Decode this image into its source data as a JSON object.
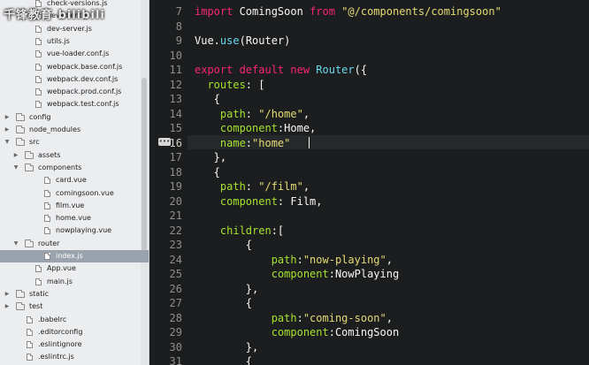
{
  "watermark": "千锋教育 bilibili",
  "sidebar": {
    "items": [
      {
        "label": "check-versions.js",
        "type": "file",
        "indent": 3
      },
      {
        "label": "dev-client.js",
        "type": "file",
        "indent": 3
      },
      {
        "label": "dev-server.js",
        "type": "file",
        "indent": 3
      },
      {
        "label": "utils.js",
        "type": "file",
        "indent": 3
      },
      {
        "label": "vue-loader.conf.js",
        "type": "file",
        "indent": 3
      },
      {
        "label": "webpack.base.conf.js",
        "type": "file",
        "indent": 3
      },
      {
        "label": "webpack.dev.conf.js",
        "type": "file",
        "indent": 3
      },
      {
        "label": "webpack.prod.conf.js",
        "type": "file",
        "indent": 3
      },
      {
        "label": "webpack.test.conf.js",
        "type": "file",
        "indent": 3
      },
      {
        "label": "config",
        "type": "folder",
        "indent": 1,
        "expanded": false
      },
      {
        "label": "node_modules",
        "type": "folder",
        "indent": 1,
        "expanded": false
      },
      {
        "label": "src",
        "type": "folder",
        "indent": 1,
        "expanded": true
      },
      {
        "label": "assets",
        "type": "folder",
        "indent": 2,
        "expanded": false
      },
      {
        "label": "components",
        "type": "folder",
        "indent": 2,
        "expanded": true
      },
      {
        "label": "card.vue",
        "type": "file",
        "indent": 4
      },
      {
        "label": "comingsoon.vue",
        "type": "file",
        "indent": 4
      },
      {
        "label": "film.vue",
        "type": "file",
        "indent": 4
      },
      {
        "label": "home.vue",
        "type": "file",
        "indent": 4
      },
      {
        "label": "nowplaying.vue",
        "type": "file",
        "indent": 4
      },
      {
        "label": "router",
        "type": "folder",
        "indent": 2,
        "expanded": true
      },
      {
        "label": "index.js",
        "type": "file",
        "indent": 4,
        "selected": true
      },
      {
        "label": "App.vue",
        "type": "file",
        "indent": 3
      },
      {
        "label": "main.js",
        "type": "file",
        "indent": 3
      },
      {
        "label": "static",
        "type": "folder",
        "indent": 1,
        "expanded": false
      },
      {
        "label": "test",
        "type": "folder",
        "indent": 1,
        "expanded": false
      },
      {
        "label": ".babelrc",
        "type": "file",
        "indent": 2
      },
      {
        "label": ".editorconfig",
        "type": "file",
        "indent": 2
      },
      {
        "label": ".eslintignore",
        "type": "file",
        "indent": 2
      },
      {
        "label": ".eslintrc.js",
        "type": "file",
        "indent": 2
      }
    ]
  },
  "editor": {
    "active_line": "16",
    "fold_marker": "•••",
    "line_numbers": [
      "7",
      "8",
      "9",
      "10",
      "11",
      "12",
      "13",
      "14",
      "15",
      "16",
      "17",
      "18",
      "19",
      "20",
      "21",
      "22",
      "23",
      "24",
      "25",
      "26",
      "27",
      "28",
      "29",
      "30",
      "31"
    ],
    "lines": [
      [
        {
          "t": "import ",
          "c": "kw"
        },
        {
          "t": "ComingSoon ",
          "c": "txt"
        },
        {
          "t": "from ",
          "c": "kw"
        },
        {
          "t": "\"@/components/comingsoon\"",
          "c": "str"
        }
      ],
      [],
      [
        {
          "t": "Vue.",
          "c": "txt"
        },
        {
          "t": "use",
          "c": "fn"
        },
        {
          "t": "(Router)",
          "c": "txt"
        }
      ],
      [],
      [
        {
          "t": "export ",
          "c": "kw"
        },
        {
          "t": "default ",
          "c": "kw"
        },
        {
          "t": "new ",
          "c": "kw"
        },
        {
          "t": "Router",
          "c": "fn"
        },
        {
          "t": "({",
          "c": "txt"
        }
      ],
      [
        {
          "t": "  routes",
          "c": "prop"
        },
        {
          "t": ": [",
          "c": "txt"
        }
      ],
      [
        {
          "t": "   {",
          "c": "txt"
        }
      ],
      [
        {
          "t": "    path",
          "c": "prop"
        },
        {
          "t": ": ",
          "c": "txt"
        },
        {
          "t": "\"/home\"",
          "c": "str"
        },
        {
          "t": ",",
          "c": "txt"
        }
      ],
      [
        {
          "t": "    component",
          "c": "prop"
        },
        {
          "t": ":Home,",
          "c": "txt"
        }
      ],
      [
        {
          "t": "    name",
          "c": "prop"
        },
        {
          "t": ":",
          "c": "txt"
        },
        {
          "t": "\"home\"",
          "c": "str"
        }
      ],
      [
        {
          "t": "   },",
          "c": "txt"
        }
      ],
      [
        {
          "t": "   {",
          "c": "txt"
        }
      ],
      [
        {
          "t": "    path",
          "c": "prop"
        },
        {
          "t": ": ",
          "c": "txt"
        },
        {
          "t": "\"/film\"",
          "c": "str"
        },
        {
          "t": ",",
          "c": "txt"
        }
      ],
      [
        {
          "t": "    component",
          "c": "prop"
        },
        {
          "t": ": Film,",
          "c": "txt"
        }
      ],
      [],
      [
        {
          "t": "    children",
          "c": "prop"
        },
        {
          "t": ":[",
          "c": "txt"
        }
      ],
      [
        {
          "t": "        {",
          "c": "txt"
        }
      ],
      [
        {
          "t": "            path",
          "c": "prop"
        },
        {
          "t": ":",
          "c": "txt"
        },
        {
          "t": "\"now-playing\"",
          "c": "str"
        },
        {
          "t": ",",
          "c": "txt"
        }
      ],
      [
        {
          "t": "            component",
          "c": "prop"
        },
        {
          "t": ":NowPlaying",
          "c": "txt"
        }
      ],
      [
        {
          "t": "        },",
          "c": "txt"
        }
      ],
      [
        {
          "t": "        {",
          "c": "txt"
        }
      ],
      [
        {
          "t": "            path",
          "c": "prop"
        },
        {
          "t": ":",
          "c": "txt"
        },
        {
          "t": "\"coming-soon\"",
          "c": "str"
        },
        {
          "t": ",",
          "c": "txt"
        }
      ],
      [
        {
          "t": "            component",
          "c": "prop"
        },
        {
          "t": ":ComingSoon",
          "c": "txt"
        }
      ],
      [
        {
          "t": "        },",
          "c": "txt"
        }
      ],
      [
        {
          "t": "        {",
          "c": "txt"
        }
      ]
    ]
  }
}
